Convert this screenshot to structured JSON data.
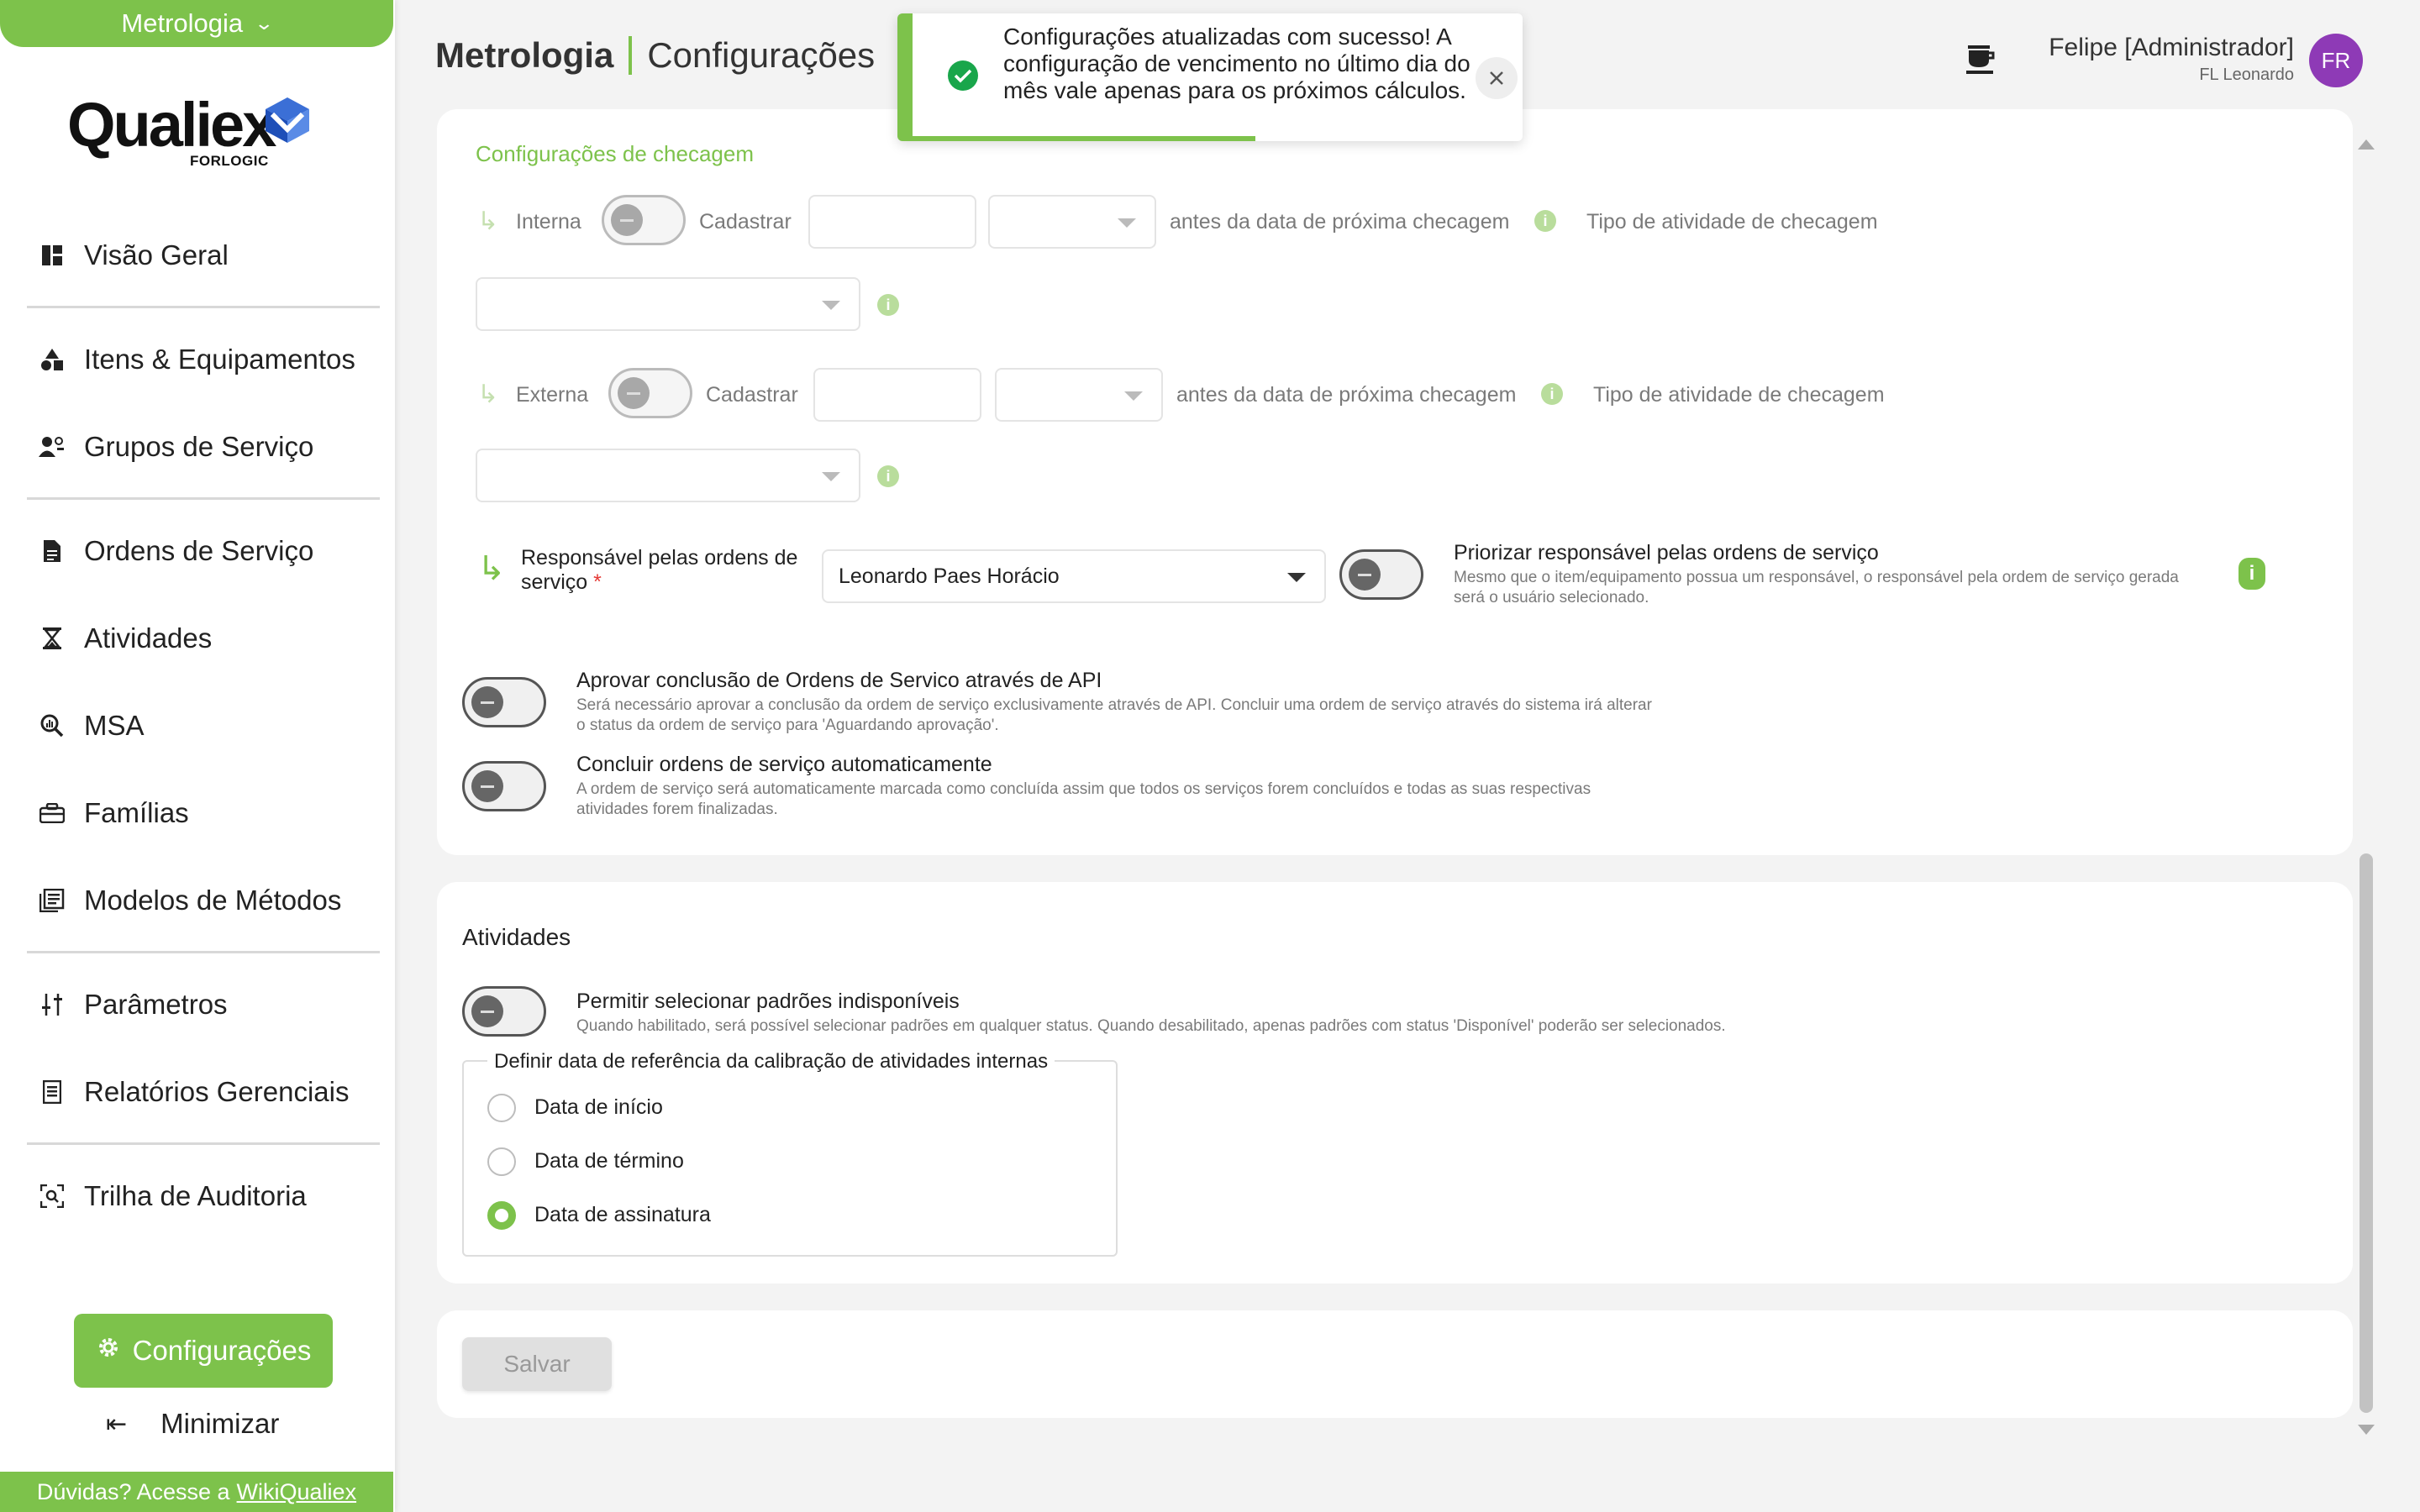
{
  "module_switch": {
    "label": "Metrologia"
  },
  "logo": {
    "word": "Qualiex",
    "sub": "FORLOGIC"
  },
  "sidebar": {
    "items": [
      {
        "label": "Visão Geral",
        "icon": "dashboard-icon"
      },
      {
        "label": "Itens & Equipamentos",
        "icon": "shapes-icon"
      },
      {
        "label": "Grupos de Serviço",
        "icon": "group-icon"
      },
      {
        "label": "Ordens de Serviço",
        "icon": "document-icon"
      },
      {
        "label": "Atividades",
        "icon": "hourglass-icon"
      },
      {
        "label": "MSA",
        "icon": "magnify-chart-icon"
      },
      {
        "label": "Famílias",
        "icon": "toolbox-icon"
      },
      {
        "label": "Modelos de Métodos",
        "icon": "library-icon"
      },
      {
        "label": "Parâmetros",
        "icon": "sliders-icon"
      },
      {
        "label": "Relatórios Gerenciais",
        "icon": "report-icon"
      },
      {
        "label": "Trilha de Auditoria",
        "icon": "audit-icon"
      }
    ],
    "config_label": "Configurações",
    "minimize_label": "Minimizar",
    "help_text": "Dúvidas? Acesse a",
    "help_link": "WikiQualiex"
  },
  "header": {
    "module": "Metrologia",
    "section": "Configurações",
    "user_name": "Felipe [Administrador]",
    "user_sub": "FL Leonardo",
    "avatar_initials": "FR"
  },
  "toast": {
    "message": "Configurações atualizadas com sucesso! A configuração de vencimento no último dia do mês vale apenas para os próximos cálculos."
  },
  "checagem": {
    "section_title": "Configurações de checagem",
    "interna_label": "Interna",
    "externa_label": "Externa",
    "cadastrar_label": "Cadastrar",
    "antes_label": "antes da data de próxima checagem",
    "tipo_label": "Tipo de atividade de checagem",
    "responsavel_label": "Responsável pelas ordens de serviço",
    "required_mark": "*",
    "responsavel_value": "Leonardo Paes Horácio",
    "priorizar_title": "Priorizar responsável pelas ordens de serviço",
    "priorizar_desc": "Mesmo que o item/equipamento possua um responsável, o responsável pela ordem de serviço gerada será o usuário selecionado.",
    "aprovar_title": "Aprovar conclusão de Ordens de Servico através de API",
    "aprovar_desc": "Será necessário aprovar a conclusão da ordem de serviço exclusivamente através de API. Concluir uma ordem de serviço através do sistema irá alterar o status da ordem de serviço para 'Aguardando aprovação'.",
    "concluir_title": "Concluir ordens de serviço automaticamente",
    "concluir_desc": "A ordem de serviço será automaticamente marcada como concluída assim que todos os serviços forem concluídos e todas as suas respectivas atividades forem finalizadas."
  },
  "atividades": {
    "section_title": "Atividades",
    "permitir_title": "Permitir selecionar padrões indisponíveis",
    "permitir_desc": "Quando habilitado, será possível selecionar padrões em qualquer status. Quando desabilitado, apenas padrões com status 'Disponível' poderão ser selecionados.",
    "fieldset_legend": "Definir data de referência da calibração de atividades internas",
    "options": [
      "Data de início",
      "Data de término",
      "Data de assinatura"
    ],
    "selected_option": "Data de assinatura"
  },
  "save_label": "Salvar",
  "colors": {
    "accent": "#7dc24b",
    "avatar": "#8e3ab6",
    "success": "#19a64b"
  }
}
